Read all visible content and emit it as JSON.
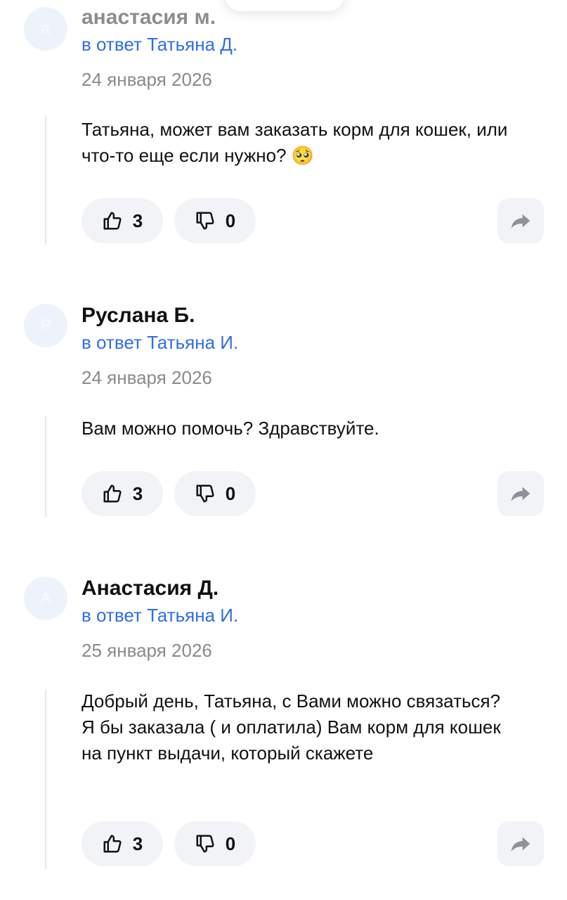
{
  "comments": [
    {
      "avatar_letter": "а",
      "author": "анастасия м.",
      "reply_to": "в ответ Татьяна Д.",
      "date": "24 января 2026",
      "text": "Татьяна, может вам заказать корм для кошек, или что-то еще если нужно?",
      "emoji": "🥺",
      "likes": "3",
      "dislikes": "0"
    },
    {
      "avatar_letter": "Р",
      "author": "Руслана Б.",
      "reply_to": "в ответ Татьяна И.",
      "date": "24 января 2026",
      "text": "Вам можно помочь? Здравствуйте.",
      "likes": "3",
      "dislikes": "0"
    },
    {
      "avatar_letter": "А",
      "author": "Анастасия Д.",
      "reply_to": "в ответ Татьяна И.",
      "date": "25 января 2026",
      "text": "Добрый день, Татьяна, с Вами можно связаться? Я бы заказала ( и оплатила) Вам корм для кошек на пункт выдачи, который скажете",
      "likes": "3",
      "dislikes": "0"
    }
  ],
  "icons": {
    "like": "thumbs-up-icon",
    "dislike": "thumbs-down-icon",
    "share": "share-arrow-icon"
  },
  "colors": {
    "reply_link": "#2f6ee5",
    "date": "#8a8a8a",
    "button_bg": "#f1f3f6"
  }
}
